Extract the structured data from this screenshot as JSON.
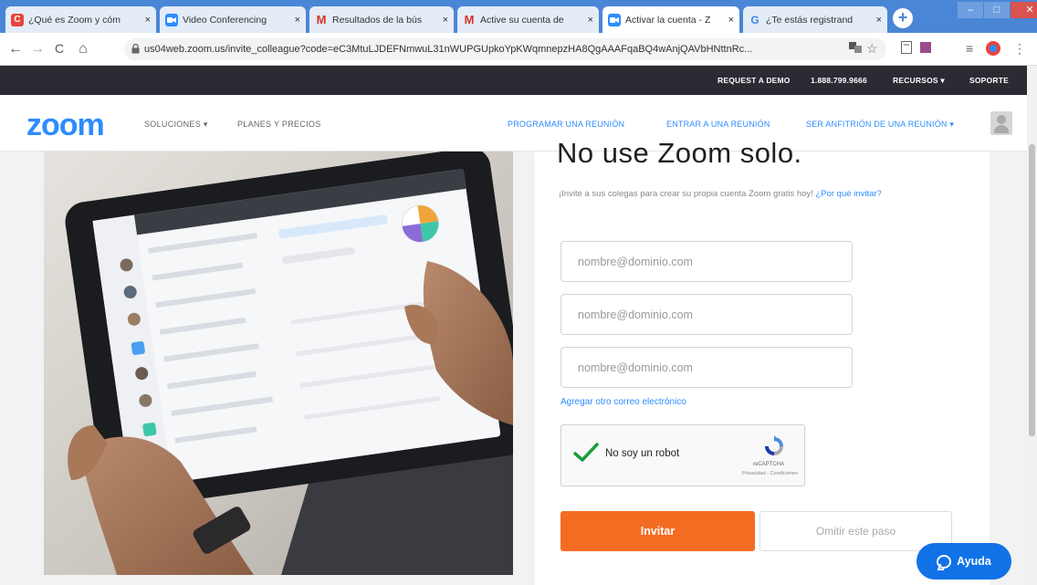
{
  "browser": {
    "tabs": [
      {
        "label": "¿Qué es Zoom y cóm",
        "favicon": "C",
        "favicon_color": "#e8453c",
        "active": false
      },
      {
        "label": "Video Conferencing",
        "favicon": "",
        "favicon_color": "#2d8cff",
        "active": false
      },
      {
        "label": "Resultados de la bús",
        "favicon": "M",
        "favicon_color": "#d93025",
        "active": false
      },
      {
        "label": "Active su cuenta de",
        "favicon": "M",
        "favicon_color": "#d93025",
        "active": false
      },
      {
        "label": "Activar la cuenta - Z",
        "favicon": "",
        "favicon_color": "#2d8cff",
        "active": true
      },
      {
        "label": "¿Te estás registrand",
        "favicon": "G",
        "favicon_color": "#4285f4",
        "active": false
      }
    ],
    "tab_close": "×",
    "new_tab": "+",
    "window_controls": [
      "–",
      "□",
      "✕"
    ],
    "url": "us04web.zoom.us/invite_colleague?code=eC3MtuLJDEFNmwuL31nWUPGUpkoYpKWqmnepzHA8QgAAAFqaBQ4wAnjQAVbHNttnRc...",
    "nav_icons": [
      "←",
      "→",
      "C",
      "⌂"
    ]
  },
  "topbar": {
    "links": [
      "REQUEST A DEMO",
      "1.888.799.9666",
      "RECURSOS ▾",
      "SOPORTE"
    ]
  },
  "nav": {
    "logo": "zoom",
    "left_items": [
      "SOLUCIONES ▾",
      "PLANES Y PRECIOS"
    ],
    "right_items": [
      "PROGRAMAR UNA REUNIÓN",
      "ENTRAR A UNA REUNIÓN",
      "SER ANFITRIÓN DE UNA REUNIÓN ▾"
    ]
  },
  "content": {
    "headline": "No use Zoom solo.",
    "subtitle": "¡Invite a sus colegas para crear su propia cuenta Zoom gratis hoy!",
    "why_invite": "¿Por qué invitar?",
    "email_placeholders": [
      "nombre@dominio.com",
      "nombre@dominio.com",
      "nombre@dominio.com"
    ],
    "add_email": "Agregar otro correo electrónico",
    "captcha": {
      "label": "No soy un robot",
      "brand": "reCAPTCHA",
      "privacy": "Privacidad - Condiciones"
    },
    "invite_button": "Invitar",
    "skip_button": "Omitir este paso"
  },
  "help": {
    "label": "Ayuda"
  },
  "colors": {
    "zoom_blue": "#2d8cff",
    "invite_orange": "#f36c21",
    "dark_bar": "#2a2b33",
    "help_blue": "#1172e8",
    "chrome_blue": "#4a86d6"
  }
}
